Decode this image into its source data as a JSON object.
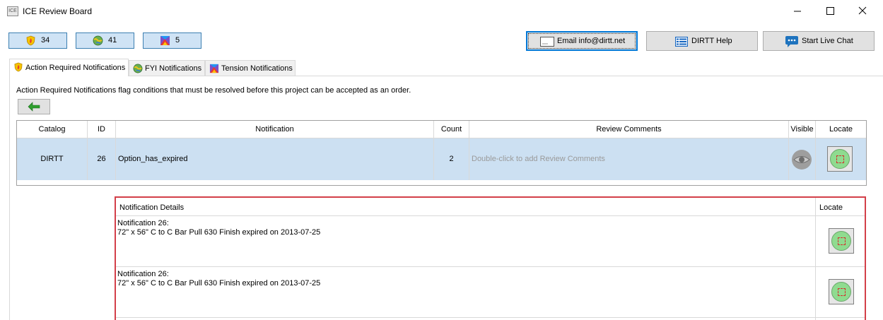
{
  "window": {
    "title": "ICE Review Board",
    "app_icon_text": "ICE"
  },
  "badges": [
    {
      "icon": "shield-flame-icon",
      "count": "34"
    },
    {
      "icon": "globe-icon",
      "count": "41"
    },
    {
      "icon": "tension-cube-icon",
      "count": "5"
    }
  ],
  "buttons": {
    "email": "Email info@dirtt.net",
    "help": "DIRTT Help",
    "chat": "Start Live Chat"
  },
  "tabs": [
    {
      "label": "Action Required Notifications",
      "icon": "shield-flame-icon",
      "active": true
    },
    {
      "label": "FYI Notifications",
      "icon": "globe-icon",
      "active": false
    },
    {
      "label": "Tension Notifications",
      "icon": "tension-cube-icon",
      "active": false
    }
  ],
  "description": "Action Required Notifications flag conditions that must be resolved before this project can be accepted as an order.",
  "table": {
    "headers": {
      "catalog": "Catalog",
      "id": "ID",
      "notification": "Notification",
      "count": "Count",
      "comments": "Review Comments",
      "visible": "Visible",
      "locate": "Locate"
    },
    "rows": [
      {
        "catalog": "DIRTT",
        "id": "26",
        "notification": "Option_has_expired",
        "count": "2",
        "comments_hint": "Double-click to add Review Comments"
      }
    ]
  },
  "details": {
    "header": "Notification Details",
    "locate_header": "Locate",
    "rows": [
      {
        "line1": "Notification 26:",
        "line2": "72\" x 56\" C to C Bar Pull 630 Finish expired on 2013-07-25"
      },
      {
        "line1": "Notification 26:",
        "line2": "72\" x 56\" C to C Bar Pull 630 Finish expired on 2013-07-25"
      }
    ]
  },
  "colors": {
    "selected_row": "#cce0f2",
    "badge_bg": "#cfe3f5",
    "details_border": "#d33f49",
    "locate_green": "#8fdb8f"
  }
}
